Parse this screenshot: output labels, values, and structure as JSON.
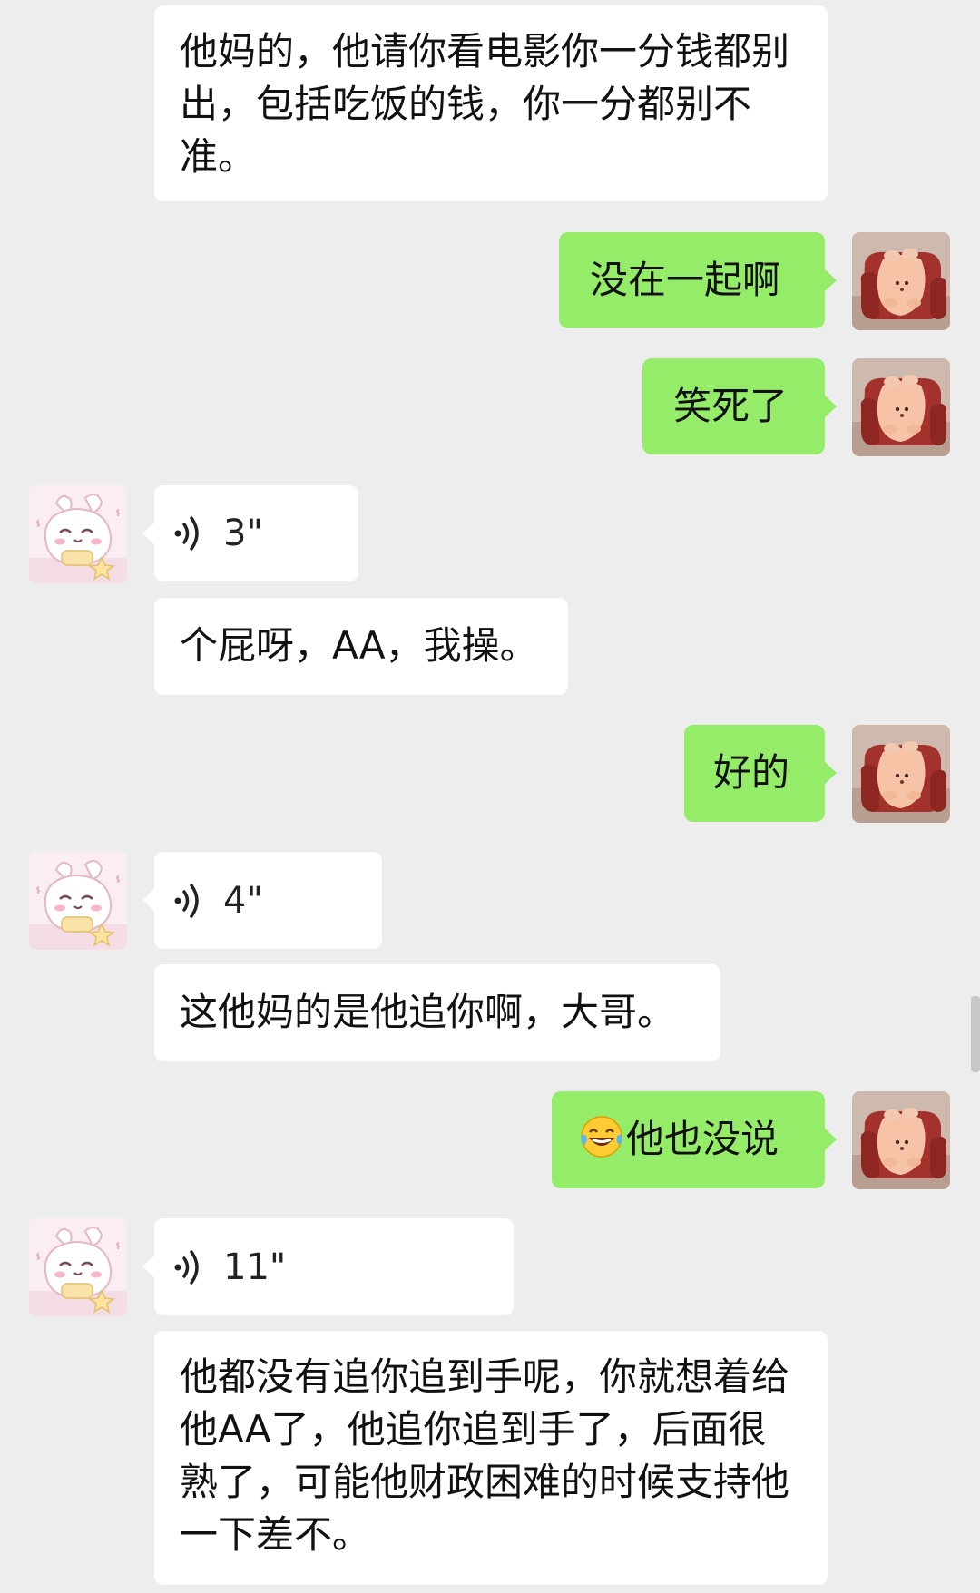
{
  "messages": [
    {
      "side": "them",
      "type": "text",
      "text": "他妈的，他请你看电影你一分钱都别出，包括吃饭的钱，你一分都别不准。"
    },
    {
      "side": "me",
      "type": "text",
      "text": "没在一起啊"
    },
    {
      "side": "me",
      "type": "text",
      "text": "笑死了"
    },
    {
      "side": "them",
      "type": "voice",
      "duration": "3\""
    },
    {
      "side": "them",
      "type": "text",
      "text": "个屁呀，AA，我操。"
    },
    {
      "side": "me",
      "type": "text",
      "text": "好的"
    },
    {
      "side": "them",
      "type": "voice",
      "duration": "4\""
    },
    {
      "side": "them",
      "type": "text",
      "text": "这他妈的是他追你啊，大哥。"
    },
    {
      "side": "me",
      "type": "text",
      "emoji": "laughing-tears",
      "text": "他也没说"
    },
    {
      "side": "them",
      "type": "voice",
      "duration": "11\""
    },
    {
      "side": "them",
      "type": "text",
      "text": "他都没有追你追到手呢，你就想着给他AA了，他追你追到手了，后面很熟了，可能他财政困难的时候支持他一下差不。"
    }
  ],
  "avatars": {
    "me": "sofa-plush-avatar",
    "them": "cartoon-bunny-avatar"
  },
  "colors": {
    "background": "#ededed",
    "sent_bubble": "#95ec69",
    "received_bubble": "#ffffff"
  },
  "icons": {
    "voice": "voice-wave-icon"
  }
}
